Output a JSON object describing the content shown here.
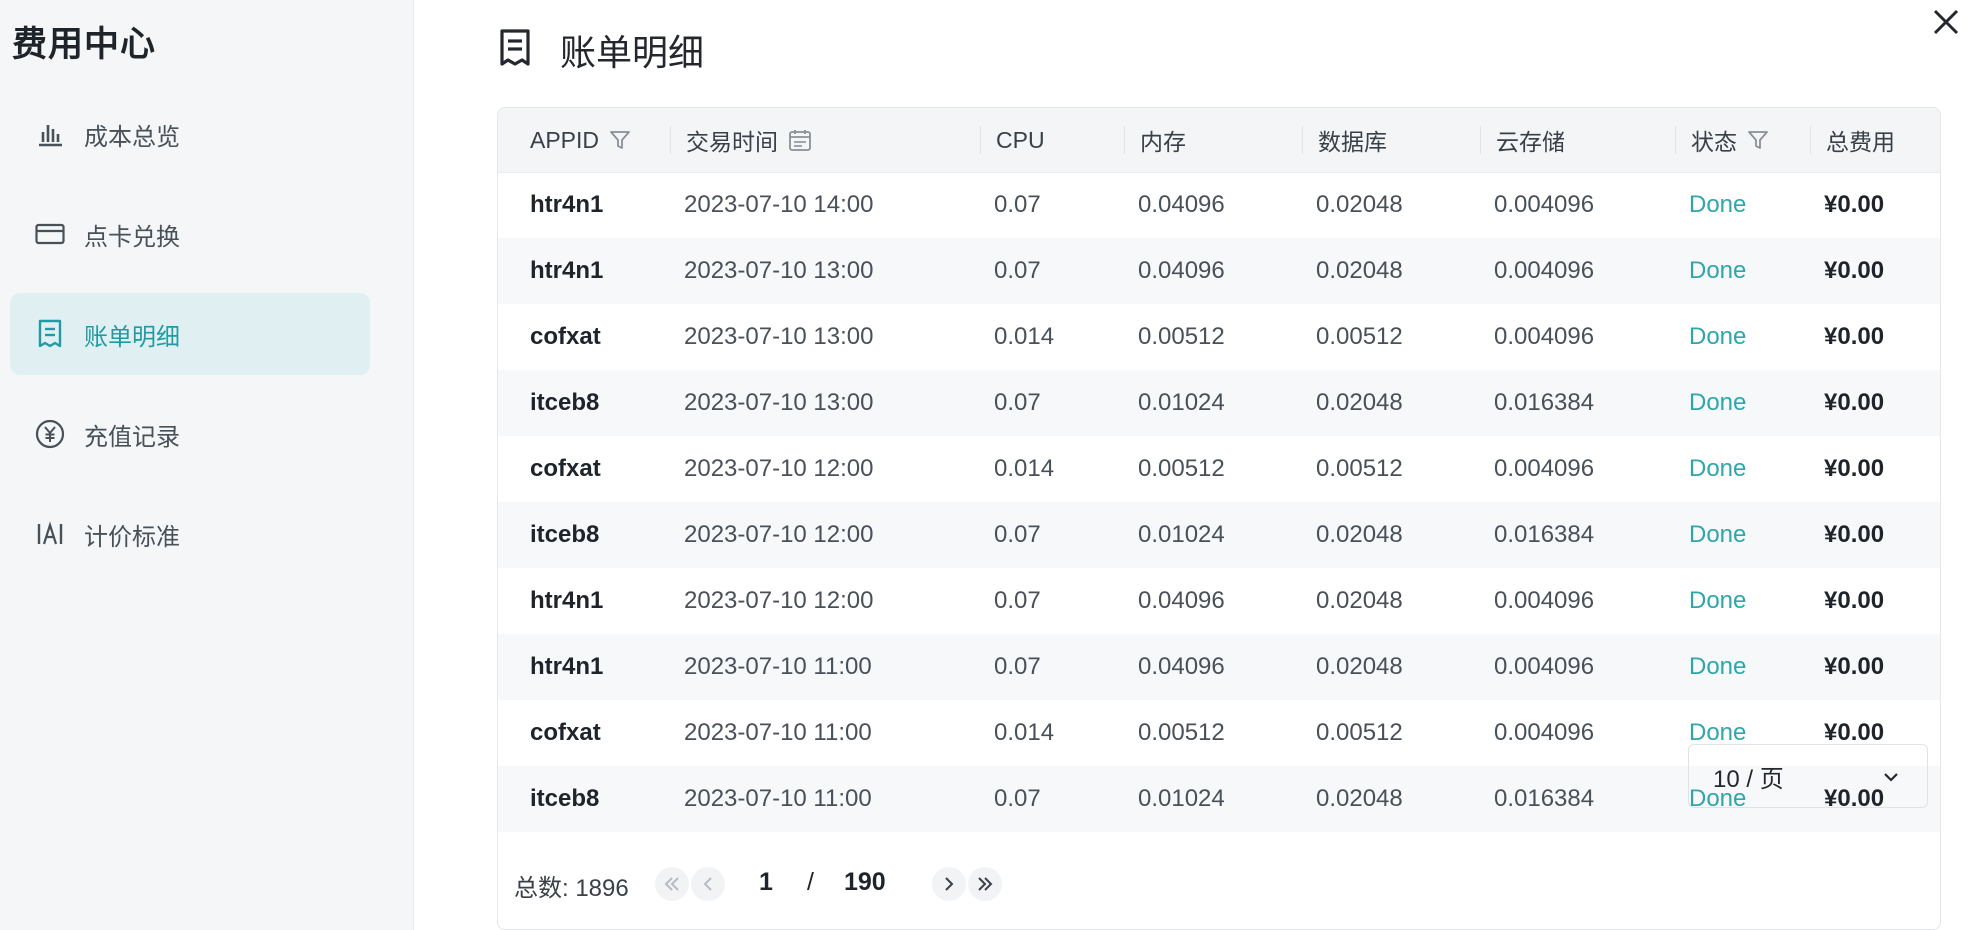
{
  "sidebar": {
    "title": "费用中心",
    "items": [
      {
        "label": "成本总览",
        "icon": "bar-chart-icon",
        "active": false
      },
      {
        "label": "点卡兑换",
        "icon": "card-icon",
        "active": false
      },
      {
        "label": "账单明细",
        "icon": "receipt-icon",
        "active": true
      },
      {
        "label": "充值记录",
        "icon": "yen-circle-icon",
        "active": false
      },
      {
        "label": "计价标准",
        "icon": "pricing-icon",
        "active": false
      }
    ]
  },
  "page": {
    "title": "账单明细",
    "icon": "receipt-icon",
    "close_icon": "close-icon"
  },
  "table": {
    "columns": [
      "APPID",
      "交易时间",
      "CPU",
      "内存",
      "数据库",
      "云存储",
      "状态",
      "总费用"
    ],
    "rows": [
      [
        "htr4n1",
        "2023-07-10 14:00",
        "0.07",
        "0.04096",
        "0.02048",
        "0.004096",
        "Done",
        "¥0.00"
      ],
      [
        "htr4n1",
        "2023-07-10 13:00",
        "0.07",
        "0.04096",
        "0.02048",
        "0.004096",
        "Done",
        "¥0.00"
      ],
      [
        "cofxat",
        "2023-07-10 13:00",
        "0.014",
        "0.00512",
        "0.00512",
        "0.004096",
        "Done",
        "¥0.00"
      ],
      [
        "itceb8",
        "2023-07-10 13:00",
        "0.07",
        "0.01024",
        "0.02048",
        "0.016384",
        "Done",
        "¥0.00"
      ],
      [
        "cofxat",
        "2023-07-10 12:00",
        "0.014",
        "0.00512",
        "0.00512",
        "0.004096",
        "Done",
        "¥0.00"
      ],
      [
        "itceb8",
        "2023-07-10 12:00",
        "0.07",
        "0.01024",
        "0.02048",
        "0.016384",
        "Done",
        "¥0.00"
      ],
      [
        "htr4n1",
        "2023-07-10 12:00",
        "0.07",
        "0.04096",
        "0.02048",
        "0.004096",
        "Done",
        "¥0.00"
      ],
      [
        "htr4n1",
        "2023-07-10 11:00",
        "0.07",
        "0.04096",
        "0.02048",
        "0.004096",
        "Done",
        "¥0.00"
      ],
      [
        "cofxat",
        "2023-07-10 11:00",
        "0.014",
        "0.00512",
        "0.00512",
        "0.004096",
        "Done",
        "¥0.00"
      ],
      [
        "itceb8",
        "2023-07-10 11:00",
        "0.07",
        "0.01024",
        "0.02048",
        "0.016384",
        "Done",
        "¥0.00"
      ]
    ]
  },
  "pagination": {
    "total_label": "总数: 1896",
    "current_page": "1",
    "separator": "/",
    "total_pages": "190",
    "page_size": "10 / 页"
  },
  "colors": {
    "accent": "#2fa6aa",
    "active_bg": "#e0f0f2",
    "sidebar_bg": "#f4f6f8"
  }
}
